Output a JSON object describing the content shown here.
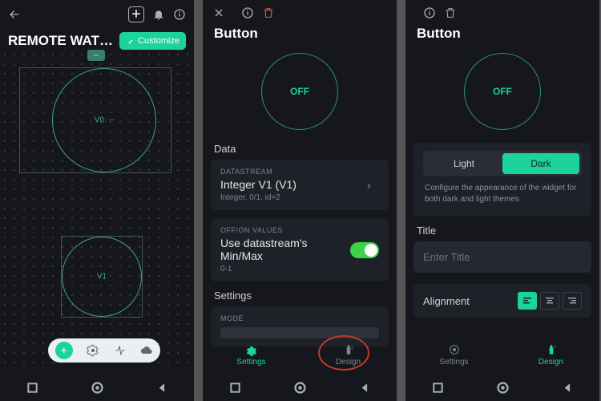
{
  "s1": {
    "title": "REMOTE WATERI...",
    "customize": "Customize",
    "mini_label": "--",
    "circle1": "V0: --",
    "circle2": "V1"
  },
  "s2": {
    "title": "Button",
    "preview_state": "OFF",
    "data_section": "Data",
    "datastream_label": "DATASTREAM",
    "datastream_value": "Integer V1 (V1)",
    "datastream_hint": "Integer, 0/1, id=2",
    "offon_label": "OFF/ON VALUES",
    "offon_value": "Use datastream's Min/Max",
    "offon_hint": "0-1",
    "settings_section": "Settings",
    "mode_label": "MODE",
    "tab_settings": "Settings",
    "tab_design": "Design"
  },
  "s3": {
    "title": "Button",
    "preview_state": "OFF",
    "seg_light": "Light",
    "seg_dark": "Dark",
    "theme_desc": "Configure the appearance of the widget for both dark and light themes",
    "title_section": "Title",
    "title_placeholder": "Enter Title",
    "alignment_label": "Alignment",
    "tab_settings": "Settings",
    "tab_design": "Design"
  }
}
